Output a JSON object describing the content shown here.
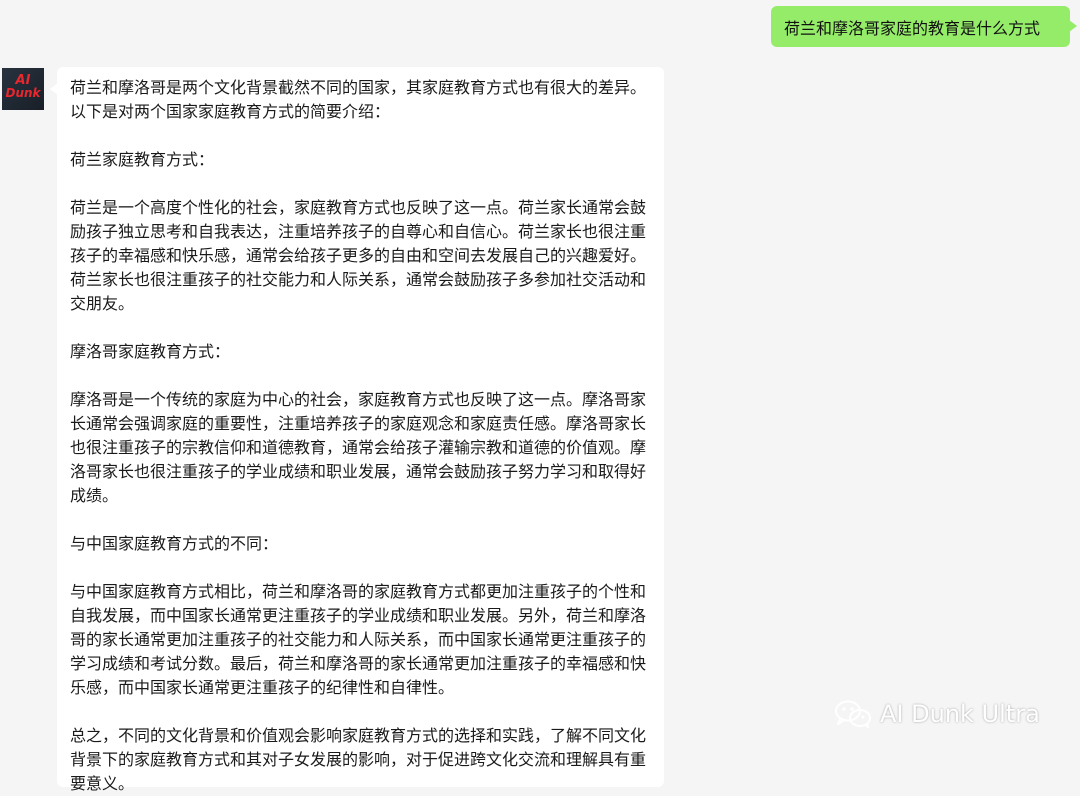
{
  "chat": {
    "user_message": "荷兰和摩洛哥家庭的教育是什么方式",
    "avatar_text": [
      "AI",
      "Dunk"
    ],
    "bot_paragraphs": [
      "荷兰和摩洛哥是两个文化背景截然不同的国家，其家庭教育方式也有很大的差异。以下是对两个国家家庭教育方式的简要介绍：",
      "荷兰家庭教育方式：",
      "荷兰是一个高度个性化的社会，家庭教育方式也反映了这一点。荷兰家长通常会鼓励孩子独立思考和自我表达，注重培养孩子的自尊心和自信心。荷兰家长也很注重孩子的幸福感和快乐感，通常会给孩子更多的自由和空间去发展自己的兴趣爱好。荷兰家长也很注重孩子的社交能力和人际关系，通常会鼓励孩子多参加社交活动和交朋友。",
      "摩洛哥家庭教育方式：",
      "摩洛哥是一个传统的家庭为中心的社会，家庭教育方式也反映了这一点。摩洛哥家长通常会强调家庭的重要性，注重培养孩子的家庭观念和家庭责任感。摩洛哥家长也很注重孩子的宗教信仰和道德教育，通常会给孩子灌输宗教和道德的价值观。摩洛哥家长也很注重孩子的学业成绩和职业发展，通常会鼓励孩子努力学习和取得好成绩。",
      "与中国家庭教育方式的不同：",
      "与中国家庭教育方式相比，荷兰和摩洛哥的家庭教育方式都更加注重孩子的个性和自我发展，而中国家长通常更注重孩子的学业成绩和职业发展。另外，荷兰和摩洛哥的家长通常更加注重孩子的社交能力和人际关系，而中国家长通常更注重孩子的学习成绩和考试分数。最后，荷兰和摩洛哥的家长通常更加注重孩子的幸福感和快乐感，而中国家长通常更注重孩子的纪律性和自律性。",
      "总之，不同的文化背景和价值观会影响家庭教育方式的选择和实践，了解不同文化背景下的家庭教育方式和其对子女发展的影响，对于促进跨文化交流和理解具有重要意义。"
    ]
  },
  "watermark": {
    "text": "AI Dunk Ultra",
    "icon": "wechat-icon"
  },
  "colors": {
    "background": "#f5f5f5",
    "user_bubble": "#95ec69",
    "bot_bubble": "#ffffff",
    "avatar_text": "#e8272e"
  }
}
